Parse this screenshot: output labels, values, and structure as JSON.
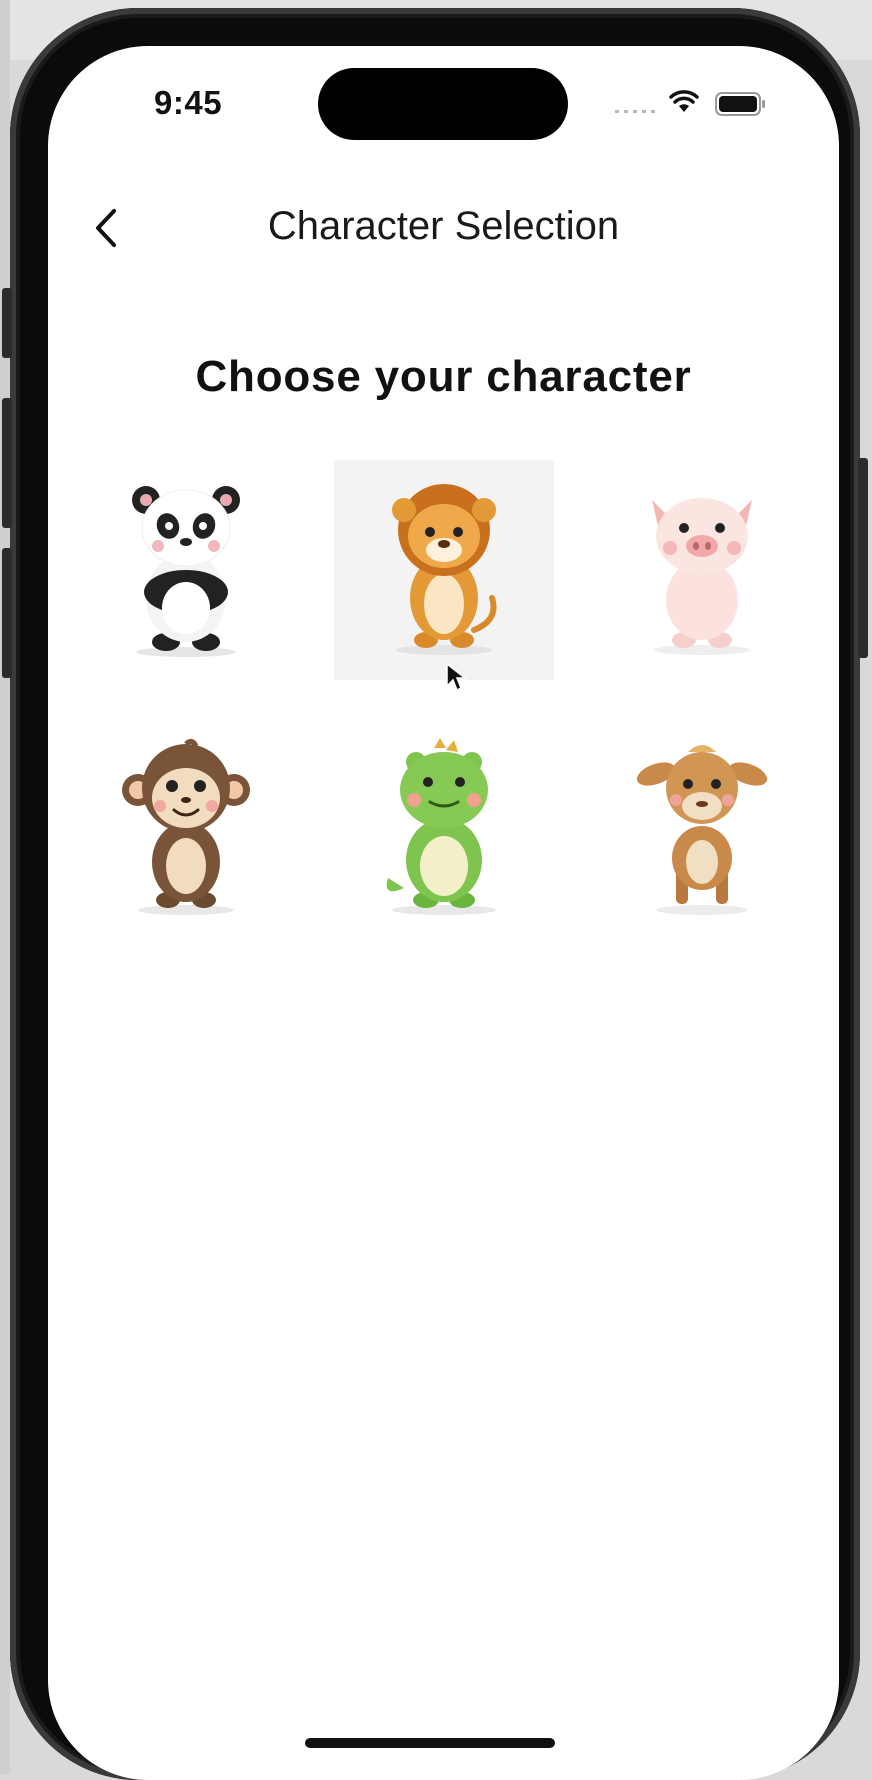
{
  "status_bar": {
    "time": "9:45"
  },
  "nav": {
    "title": "Character Selection",
    "back_icon": "chevron-left-icon"
  },
  "heading": "Choose your character",
  "characters": [
    {
      "name": "panda",
      "selected": false
    },
    {
      "name": "lion",
      "selected": true
    },
    {
      "name": "pig",
      "selected": false
    },
    {
      "name": "monkey",
      "selected": false
    },
    {
      "name": "dinosaur",
      "selected": false
    },
    {
      "name": "calf",
      "selected": false
    }
  ],
  "colors": {
    "selected_tile": "#f3f3f3",
    "background": "#ffffff",
    "text": "#111111"
  }
}
